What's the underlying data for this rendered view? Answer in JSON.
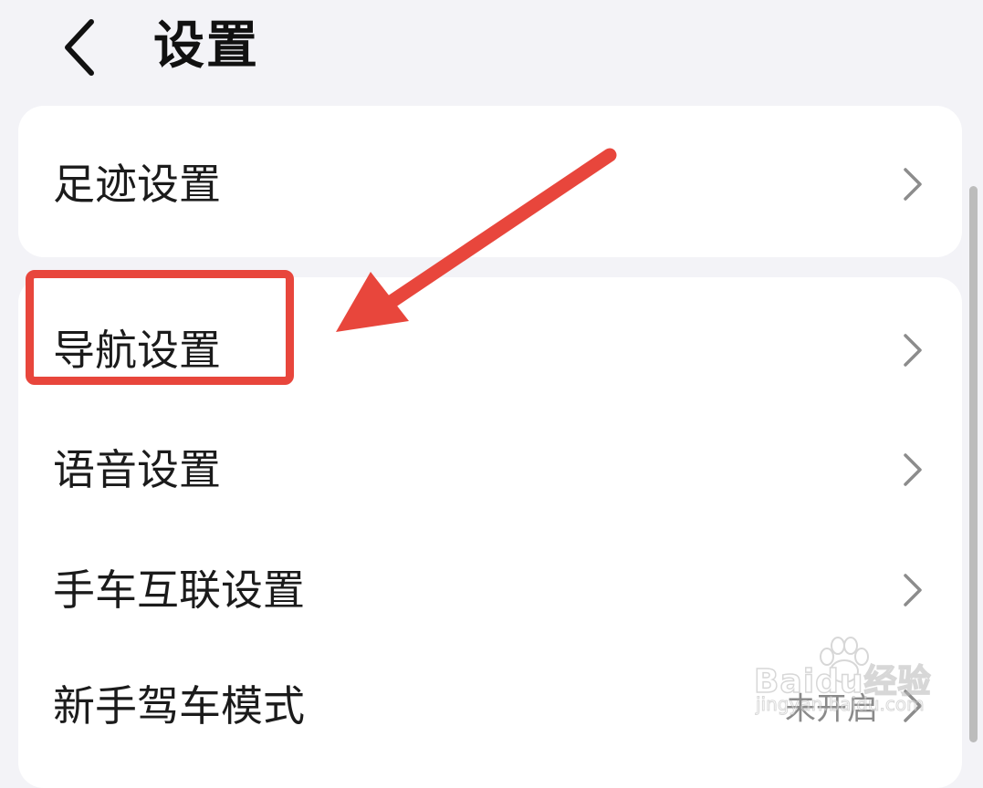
{
  "header": {
    "back_icon": "chevron-left-icon",
    "title": "设置"
  },
  "groups": [
    {
      "items": [
        {
          "label": "足迹设置",
          "chevron_icon": "chevron-right-icon"
        }
      ]
    },
    {
      "items": [
        {
          "label": "导航设置",
          "chevron_icon": "chevron-right-icon"
        },
        {
          "label": "语音设置",
          "chevron_icon": "chevron-right-icon"
        },
        {
          "label": "手车互联设置",
          "chevron_icon": "chevron-right-icon"
        },
        {
          "label": "新手驾车模式",
          "value": "未开启",
          "chevron_icon": "chevron-right-icon"
        }
      ]
    }
  ],
  "annotation": {
    "color": "#e8463c",
    "highlighted_item": "导航设置"
  },
  "watermark": {
    "brand": "Baidu经验",
    "url": "jingyan.baidu.com"
  },
  "colors": {
    "background": "#f3f3f7",
    "card": "#ffffff",
    "text": "#1b1b1b",
    "secondary_text": "#8a8a8a",
    "chevron": "#8c8c8c"
  }
}
